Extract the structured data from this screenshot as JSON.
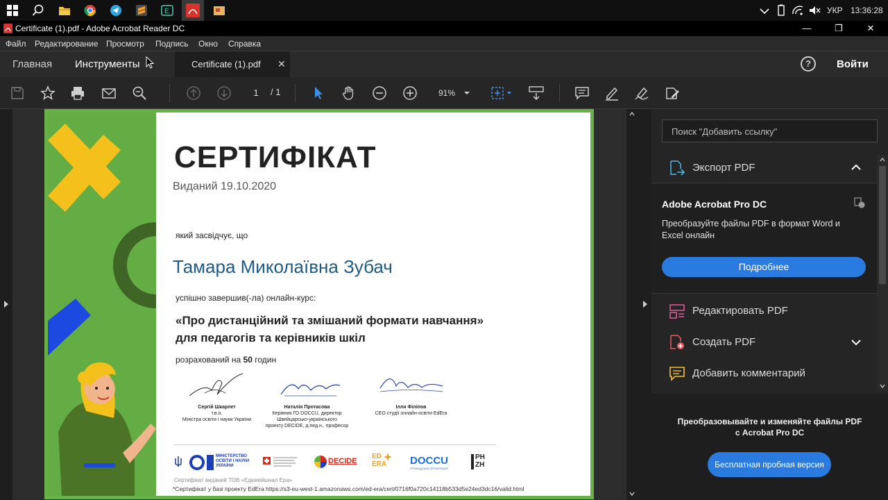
{
  "taskbar": {
    "lang": "УКР",
    "time": "13:36:28"
  },
  "window": {
    "title": "Certificate (1).pdf - Adobe Acrobat Reader DC",
    "minimize": "—",
    "maximize": "❐",
    "close": "✕"
  },
  "menu": [
    "Файл",
    "Редактирование",
    "Просмотр",
    "Подпись",
    "Окно",
    "Справка"
  ],
  "tabs": {
    "home": "Главная",
    "tools": "Инструменты",
    "doc": "Certificate (1).pdf",
    "doc_close": "✕",
    "help": "?",
    "signin": "Войти"
  },
  "toolbar": {
    "page_current": "1",
    "page_total": "/ 1",
    "zoom": "91%"
  },
  "certificate": {
    "title": "СЕРТИФІКАТ",
    "issued": "Виданий 19.10.2020",
    "certifies": "який засвідчує, що",
    "name": "Тамара Миколаївна Зубач",
    "completed": "успішно завершив(-ла) онлайн-курс:",
    "course_line1": "«Про дистанційний та змішаний формати навчання»",
    "course_line2": "для педагогів та керівників шкіл",
    "hours_prefix": "розрахований на ",
    "hours_value": "50",
    "hours_suffix": " годин",
    "signers": [
      {
        "name": "Сергій Шкарлет",
        "role1": "т.в.о.",
        "role2": "Міністра освіти і науки України",
        "role3": ""
      },
      {
        "name": "Наталія Протасова",
        "role1": "Керівник ГО DOCCU, директор",
        "role2": "Швейцарсько-українського",
        "role3": "проекту DECIDE, д.пед.н., професор"
      },
      {
        "name": "Ілля Філіпов",
        "role1": "CEO студії онлайн-освіти EdEra",
        "role2": "",
        "role3": ""
      }
    ],
    "logos": {
      "mon1": "МІНІСТЕРСТВО",
      "mon2": "ОСВІТИ І НАУКИ",
      "mon3": "УКРАЇНИ",
      "decide": "DECIDE",
      "edera1": "ED",
      "edera2": "ERA",
      "doccu": "DOCCU",
      "doccu_sub": "ГРОМАДСЬКА ОРГАНІЗАЦІЯ",
      "phzh1": "PH",
      "phzh2": "ZH"
    },
    "footer1": "Сертифікат виданий ТОВ «Едюкейшнал Ера»",
    "footer2": "*Сертифікат у базі проекту EdEra https://s3-eu-west-1.amazonaws.com/ed-era/cert/0716f0a720c14118b533d5e24ed3dc16/valid.html"
  },
  "right_panel": {
    "search_placeholder": "Поиск \"Добавить ссылку\"",
    "export_pdf": "Экспорт PDF",
    "promo_title": "Adobe Acrobat Pro DC",
    "promo_desc1": "Преобразуйте файлы PDF в формат Word и",
    "promo_desc2": "Excel онлайн",
    "promo_button": "Подробнее",
    "edit_pdf": "Редактировать PDF",
    "create_pdf": "Создать PDF",
    "add_comment": "Добавить комментарий",
    "bottom_text1": "Преобразовывайте и изменяйте файлы PDF",
    "bottom_text2": "с Acrobat Pro DC",
    "trial_button": "Бесплатная пробная версия"
  }
}
